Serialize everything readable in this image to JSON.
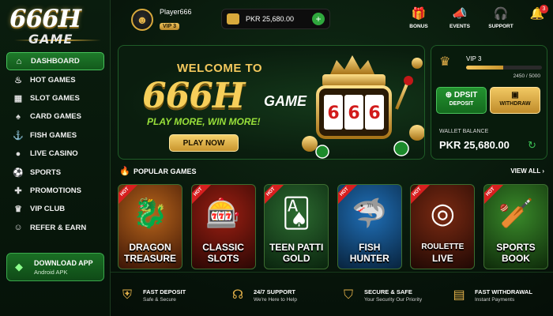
{
  "brand": {
    "logo_main": "666H",
    "logo_sub": "GAME"
  },
  "sidebar": {
    "items": [
      {
        "label": "DASHBOARD",
        "icon": "home-icon",
        "active": true
      },
      {
        "label": "HOT GAMES",
        "icon": "fire-icon"
      },
      {
        "label": "SLOT GAMES",
        "icon": "slot-machine-icon"
      },
      {
        "label": "CARD GAMES",
        "icon": "cards-icon"
      },
      {
        "label": "FISH GAMES",
        "icon": "fish-icon"
      },
      {
        "label": "LIVE CASINO",
        "icon": "user-live-icon"
      },
      {
        "label": "SPORTS",
        "icon": "soccer-ball-icon"
      },
      {
        "label": "PROMOTIONS",
        "icon": "gift-icon"
      },
      {
        "label": "VIP CLUB",
        "icon": "crown-icon"
      },
      {
        "label": "REFER & EARN",
        "icon": "referral-icon"
      }
    ],
    "download": {
      "title": "DOWNLOAD APP",
      "sub": "Android APK",
      "icon": "android-icon"
    }
  },
  "header": {
    "username": "Player666",
    "vip_badge": "VIP 3",
    "balance": "PKR 25,680.00",
    "actions": [
      {
        "label": "BONUS",
        "icon": "gift-icon"
      },
      {
        "label": "EVENTS",
        "icon": "megaphone-icon"
      },
      {
        "label": "SUPPORT",
        "icon": "headset-icon"
      }
    ],
    "notifications": "3"
  },
  "hero": {
    "welcome": "WELCOME TO",
    "title": "666H",
    "title_suffix": "GAME",
    "tagline": "PLAY MORE, WIN MORE!",
    "cta": "PLAY NOW"
  },
  "vip_panel": {
    "level": "VIP 3",
    "progress_text": "2450 / 5000",
    "progress_fraction": 0.49,
    "deposit": "DPSIT\nDEPOSIT",
    "deposit_top": "DPSIT",
    "deposit_bottom": "DEPOSIT",
    "withdraw": "WITHDRAW",
    "wallet_label": "WALLET BALANCE",
    "wallet_value": "PKR 25,680.00"
  },
  "popular": {
    "title": "POPULAR GAMES",
    "view_all": "VIEW ALL",
    "games": [
      {
        "line1": "DRAGON",
        "line2": "TREASURE",
        "badge": "HOT"
      },
      {
        "line1": "CLASSIC",
        "line2": "SLOTS",
        "badge": "HOT"
      },
      {
        "line1": "TEEN PATTI",
        "line2": "GOLD",
        "badge": "HOT"
      },
      {
        "line1": "FISH",
        "line2": "HUNTER",
        "badge": "HOT"
      },
      {
        "line1": "ROULETTE",
        "line2": "LIVE",
        "badge": "HOT"
      },
      {
        "line1": "SPORTS",
        "line2": "BOOK",
        "badge": "HOT"
      }
    ]
  },
  "features": [
    {
      "title": "FAST DEPOSIT",
      "sub": "Safe & Secure",
      "icon": "shield-check-icon"
    },
    {
      "title": "24/7 SUPPORT",
      "sub": "We're Here to Help",
      "icon": "headset-icon"
    },
    {
      "title": "SECURE & SAFE",
      "sub": "Your Security Our Priority",
      "icon": "shield-icon"
    },
    {
      "title": "FAST WITHDRAWAL",
      "sub": "Instant Payments",
      "icon": "wallet-icon"
    }
  ]
}
